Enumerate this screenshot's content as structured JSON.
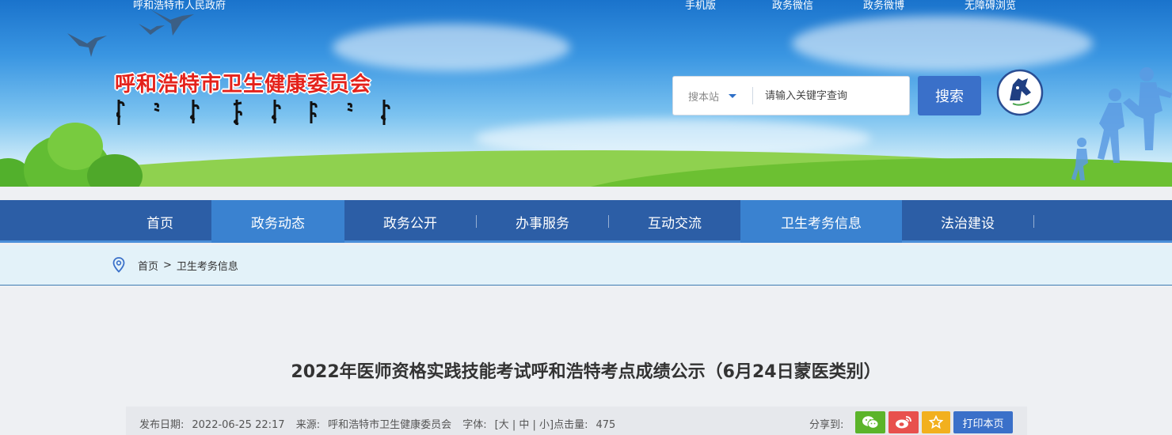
{
  "site": {
    "title": "呼和浩特市卫生健康委员会",
    "top_left_text": "呼和浩特市人民政府",
    "top_links": [
      "手机版",
      "政务微信",
      "政务微博",
      "无障碍浏览"
    ]
  },
  "search": {
    "scope_label": "搜本站",
    "placeholder": "请输入关键字查询",
    "button_label": "搜索"
  },
  "nav": {
    "items": [
      {
        "label": "首页",
        "active": false
      },
      {
        "label": "政务动态",
        "active": true
      },
      {
        "label": "政务公开",
        "active": false
      },
      {
        "label": "办事服务",
        "active": false
      },
      {
        "label": "互动交流",
        "active": false
      },
      {
        "label": "卫生考务信息",
        "active": true
      },
      {
        "label": "法治建设",
        "active": false
      }
    ]
  },
  "breadcrumb": {
    "home": "首页",
    "separator": ">",
    "current": "卫生考务信息"
  },
  "article": {
    "title": "2022年医师资格实践技能考试呼和浩特考点成绩公示（6月24日蒙医类别）",
    "meta": {
      "date_label": "发布日期:",
      "date": "2022-06-25 22:17",
      "source_label": "来源:",
      "source": "呼和浩特市卫生健康委员会",
      "font_label": "字体:",
      "font_sizes": "[大 | 中 | 小]",
      "hits_label": "点击量:",
      "hits": "475"
    },
    "share": {
      "label": "分享到:",
      "print_label": "打印本页"
    }
  },
  "colors": {
    "nav_bg": "#2c5ea6",
    "nav_active": "#3a82d0",
    "title_red": "#e4221b",
    "wechat_green": "#5bb42a",
    "weibo_red": "#e8504d",
    "favorite_orange": "#f2b01e",
    "button_blue": "#3a70c9"
  },
  "icons": [
    "location-pin-icon",
    "wechat-icon",
    "weibo-icon",
    "star-icon",
    "caret-down-icon",
    "emblem-logo",
    "bird-icon"
  ]
}
